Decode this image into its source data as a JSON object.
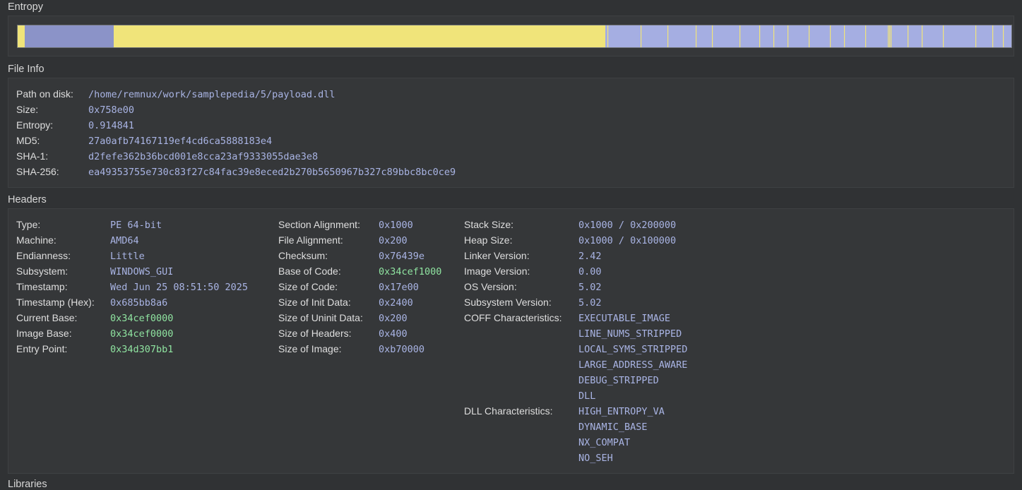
{
  "sections": {
    "entropy": "Entropy",
    "file_info": "File Info",
    "headers": "Headers",
    "next": "Libraries"
  },
  "colors": {
    "background": "#303234",
    "panel": "#353739",
    "value": "#a9b4e4",
    "address_value": "#8fe3a0",
    "entropy_high": "#a5aee2",
    "entropy_low": "#f0e47a",
    "entropy_mid": "#8b93c8"
  },
  "file_info": {
    "path_label": "Path on disk:",
    "path": "/home/remnux/work/samplepedia/5/payload.dll",
    "size_label": "Size:",
    "size": "0x758e00",
    "entropy_label": "Entropy:",
    "entropy": "0.914841",
    "md5_label": "MD5:",
    "md5": "27a0afb74167119ef4cd6ca5888183e4",
    "sha1_label": "SHA-1:",
    "sha1": "d2fefe362b36bcd001e8cca23af9333055dae3e8",
    "sha256_label": "SHA-256:",
    "sha256": "ea49353755e730c83f27c84fac39e8eced2b270b5650967b327c89bbc8bc0ce9"
  },
  "headers": {
    "col1": [
      {
        "label": "Type:",
        "value": "PE 64-bit"
      },
      {
        "label": "Machine:",
        "value": "AMD64"
      },
      {
        "label": "Endianness:",
        "value": "Little"
      },
      {
        "label": "Subsystem:",
        "value": "WINDOWS_GUI"
      },
      {
        "label": "Timestamp:",
        "value": "Wed Jun 25 08:51:50 2025"
      },
      {
        "label": "Timestamp (Hex):",
        "value": "0x685bb8a6"
      },
      {
        "label": "Current Base:",
        "value": "0x34cef0000"
      },
      {
        "label": "Image Base:",
        "value": "0x34cef0000"
      },
      {
        "label": "Entry Point:",
        "value": "0x34d307bb1"
      }
    ],
    "col2": [
      {
        "label": "Section Alignment:",
        "value": "0x1000"
      },
      {
        "label": "File Alignment:",
        "value": "0x200"
      },
      {
        "label": "Checksum:",
        "value": "0x76439e"
      },
      {
        "label": "Base of Code:",
        "value": "0x34cef1000"
      },
      {
        "label": "Size of Code:",
        "value": "0x17e00"
      },
      {
        "label": "Size of Init Data:",
        "value": "0x2400"
      },
      {
        "label": "Size of Uninit Data:",
        "value": "0x200"
      },
      {
        "label": "Size of Headers:",
        "value": "0x400"
      },
      {
        "label": "Size of Image:",
        "value": "0xb70000"
      }
    ],
    "col3": [
      {
        "label": "Stack Size:",
        "value": "0x1000 / 0x200000"
      },
      {
        "label": "Heap Size:",
        "value": "0x1000 / 0x100000"
      },
      {
        "label": "Linker Version:",
        "value": "2.42"
      },
      {
        "label": "Image Version:",
        "value": "0.00"
      },
      {
        "label": "OS Version:",
        "value": "5.02"
      },
      {
        "label": "Subsystem Version:",
        "value": "5.02"
      }
    ],
    "coff_label": "COFF Characteristics:",
    "coff": [
      "EXECUTABLE_IMAGE",
      "LINE_NUMS_STRIPPED",
      "LOCAL_SYMS_STRIPPED",
      "LARGE_ADDRESS_AWARE",
      "DEBUG_STRIPPED",
      "DLL"
    ],
    "dll_label": "DLL Characteristics:",
    "dll": [
      "HIGH_ENTROPY_VA",
      "DYNAMIC_BASE",
      "NX_COMPAT",
      "NO_SEH"
    ]
  }
}
